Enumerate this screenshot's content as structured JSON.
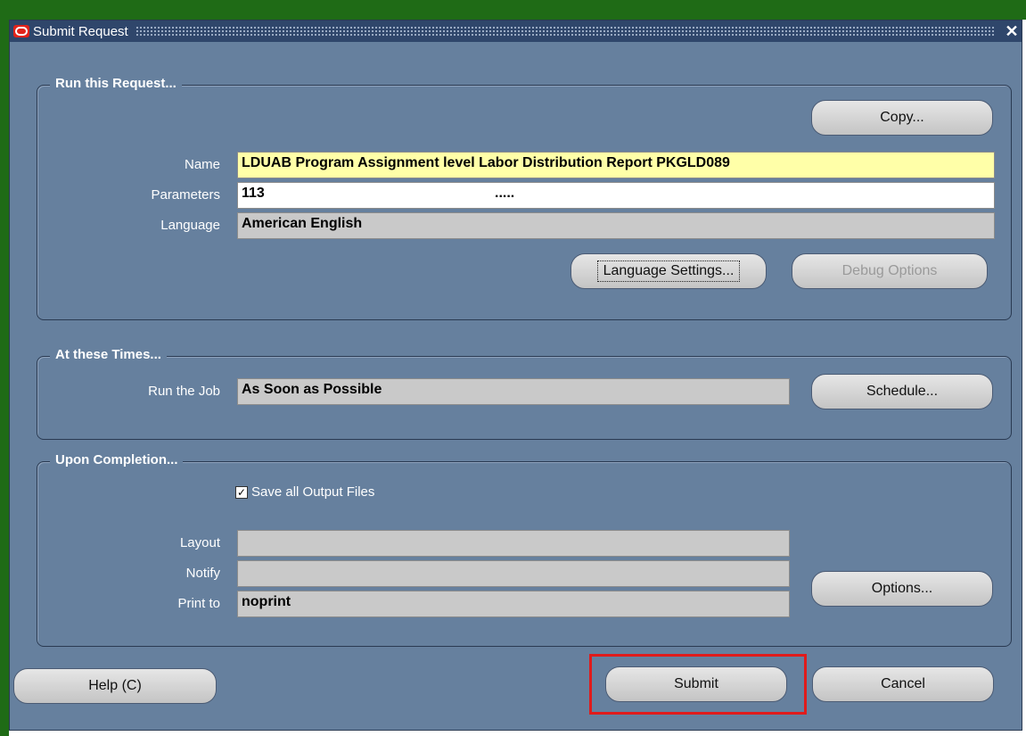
{
  "window": {
    "title": "Submit Request",
    "close_symbol": "✕"
  },
  "run_request": {
    "group_label": "Run this Request...",
    "copy_button": "Copy...",
    "name_label": "Name",
    "name_value": "LDUAB Program Assignment level Labor Distribution Report PKGLD089",
    "parameters_label": "Parameters",
    "parameters_value": "113",
    "parameters_dots": ".....",
    "language_label": "Language",
    "language_value": "American English",
    "language_settings_button": "Language Settings...",
    "debug_options_button": "Debug Options"
  },
  "times": {
    "group_label": "At these Times...",
    "run_job_label": "Run the Job",
    "run_job_value": "As Soon as Possible",
    "schedule_button": "Schedule..."
  },
  "completion": {
    "group_label": "Upon Completion...",
    "save_output_label": "Save all Output Files",
    "save_output_checked": true,
    "layout_label": "Layout",
    "layout_value": "",
    "notify_label": "Notify",
    "notify_value": "",
    "print_to_label": "Print to",
    "print_to_value": "noprint",
    "options_button": "Options..."
  },
  "footer": {
    "help_button": "Help (C)",
    "submit_button": "Submit",
    "cancel_button": "Cancel"
  },
  "colors": {
    "window_bg": "#66809e",
    "titlebar_bg": "#2f466b",
    "required_field": "#ffffa8",
    "highlight": "#e01b1b"
  },
  "icons": {
    "app_logo": "oracle-logo-icon",
    "close": "close-icon",
    "checkbox": "checkbox-checked-icon"
  }
}
